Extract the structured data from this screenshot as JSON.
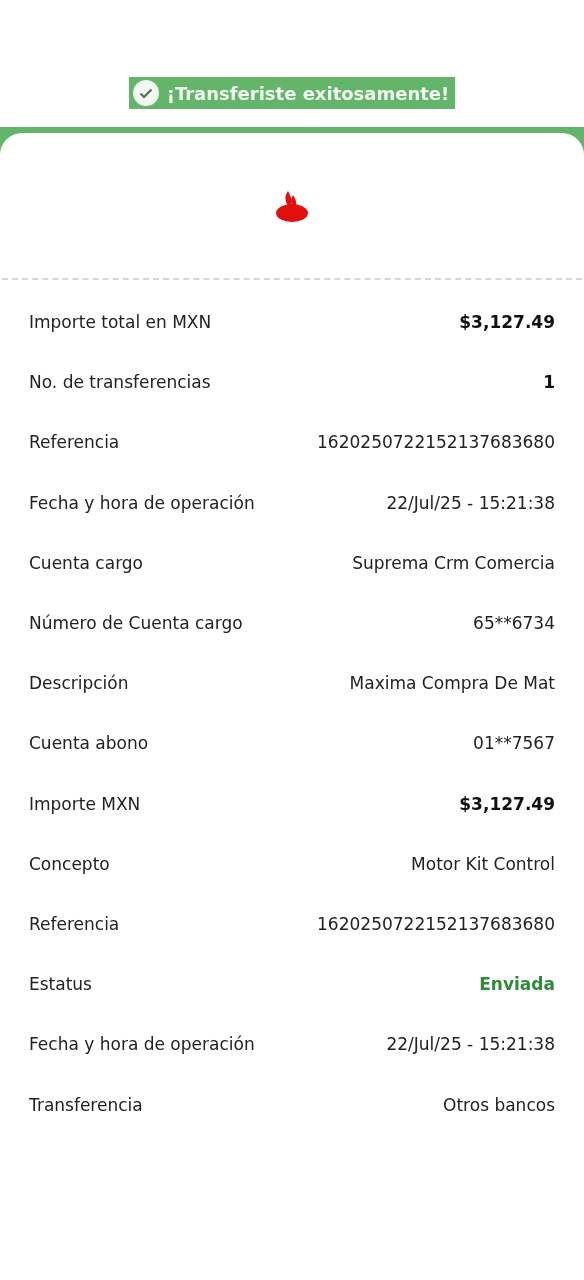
{
  "banner": {
    "text": "¡Transferiste exitosamente!"
  },
  "rows": [
    {
      "label": "Importe total en MXN",
      "value": "$3,127.49",
      "kind": "bold"
    },
    {
      "label": "No. de transferencias",
      "value": "1",
      "kind": "bold"
    },
    {
      "label": "Referencia",
      "value": "1620250722152137683680",
      "kind": "plain"
    },
    {
      "label": "Fecha y hora de operación",
      "value": "22/Jul/25 - 15:21:38",
      "kind": "plain"
    },
    {
      "label": "Cuenta cargo",
      "value": "Suprema Crm Comercia",
      "kind": "plain"
    },
    {
      "label": "Número de Cuenta cargo",
      "value": "65**6734",
      "kind": "plain"
    },
    {
      "label": "Descripción",
      "value": "Maxima Compra De Mat",
      "kind": "plain"
    },
    {
      "label": "Cuenta abono",
      "value": "01**7567",
      "kind": "plain"
    },
    {
      "label": "Importe MXN",
      "value": "$3,127.49",
      "kind": "bold"
    },
    {
      "label": "Concepto",
      "value": "Motor Kit Control",
      "kind": "plain"
    },
    {
      "label": "Referencia",
      "value": "1620250722152137683680",
      "kind": "plain"
    },
    {
      "label": "Estatus",
      "value": "Enviada",
      "kind": "status"
    },
    {
      "label": "Fecha y hora de operación",
      "value": "22/Jul/25 - 15:21:38",
      "kind": "plain"
    },
    {
      "label": "Transferencia",
      "value": "Otros bancos",
      "kind": "plain"
    }
  ]
}
